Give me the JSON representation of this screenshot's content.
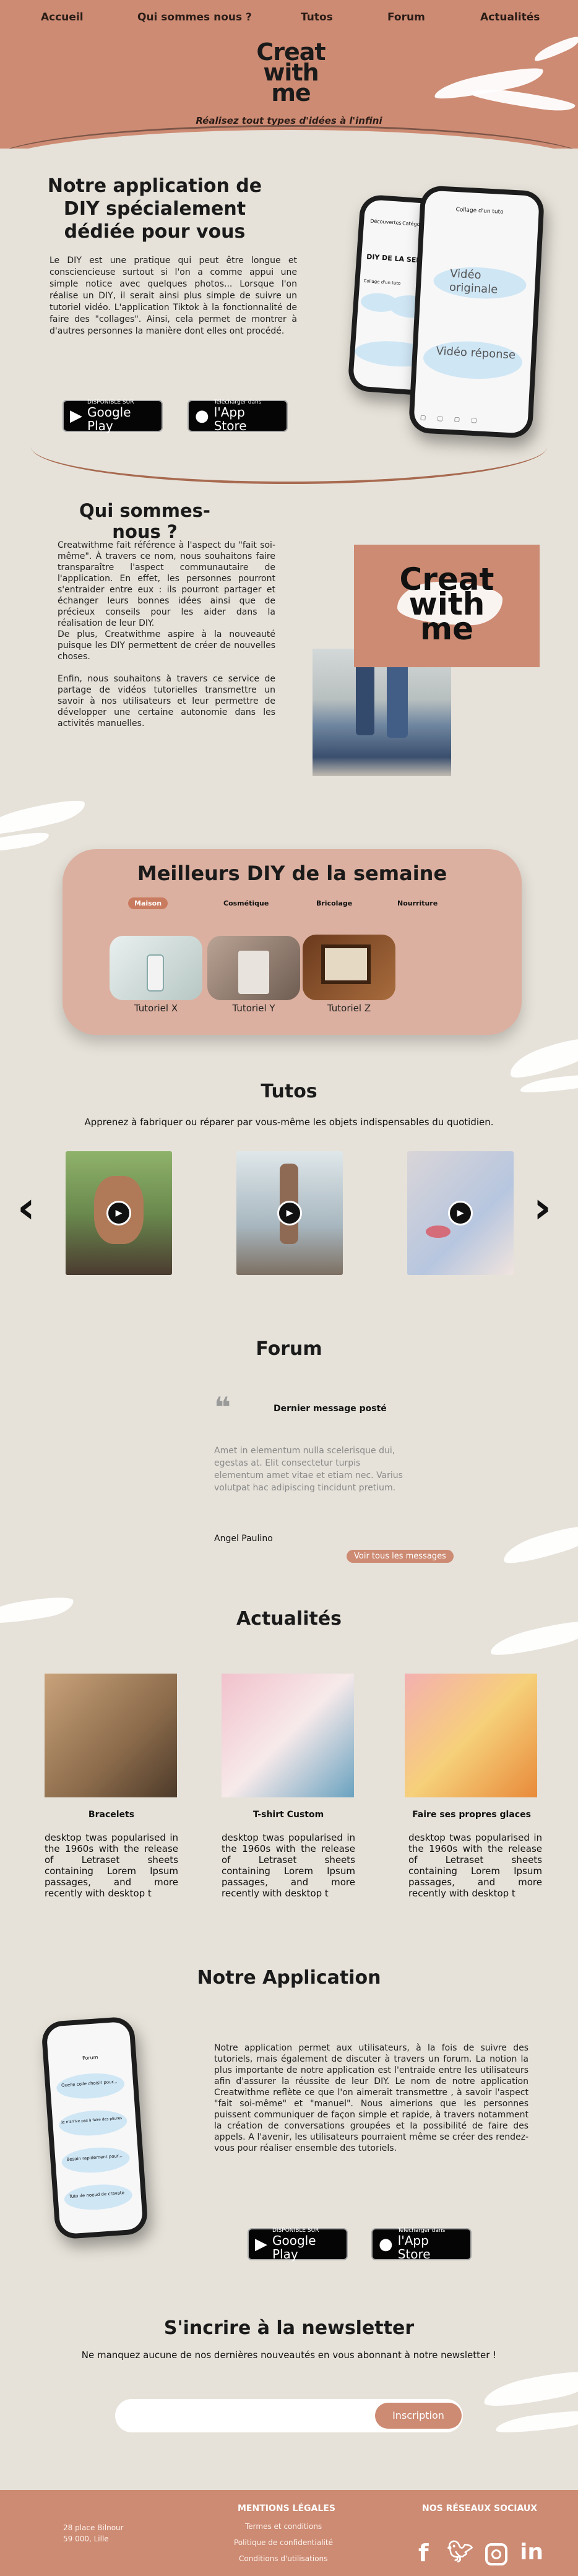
{
  "nav": {
    "accueil": "Accueil",
    "qui": "Qui sommes nous ?",
    "tutos": "Tutos",
    "forum": "Forum",
    "actualites": "Actualités"
  },
  "logo": {
    "line1": "Creat",
    "line2": "with",
    "line3": "me"
  },
  "tagline": "Réalisez tout types d'idées à l'infini",
  "intro": {
    "title": "Notre application de DIY spécialement dédiée pour vous",
    "body": "Le DIY est une pratique qui peut être longue et consciencieuse surtout si l'on a comme appui une simple notice avec quelques photos... Lorsque l'on réalise un DIY, il serait ainsi plus simple de suivre un tutoriel vidéo. L'application Tiktok à la fonctionnalité de faire des \"collages\". Ainsi, cela permet de montrer à d'autres personnes la manière dont elles ont procédé.",
    "phone_tab1": "Découvertes",
    "phone_tab2": "Catégories",
    "phone_heading": "DIY DE LA SEMAINE",
    "phone_strip": "Collage d'un tuto",
    "phone2_header": "Collage d'un tuto",
    "phone2_video1": "Vidéo originale",
    "phone2_video2": "Vidéo réponse"
  },
  "stores": {
    "google_small": "DISPONIBLE SUR",
    "google_big": "Google Play",
    "apple_small": "Télécharger dans",
    "apple_big": "l'App Store"
  },
  "about": {
    "title": "Qui sommes-nous ?",
    "body1": "Creatwithme fait référence à l'aspect du \"fait soi-même\". À travers ce nom, nous souhaitons faire transparaître l'aspect communautaire de l'application. En effet, les personnes pourront s'entraider entre eux : ils pourront partager et échanger leurs bonnes idées ainsi que de précieux conseils pour les aider dans la réalisation de leur DIY.",
    "body2": "De plus, Creatwithme aspire à la nouveauté puisque les DIY permettent de créer de nouvelles choses.",
    "body3": "Enfin, nous souhaitons à travers ce service de partage de vidéos tutorielles transmettre un savoir à nos utilisateurs et leur permettre de développer une certaine autonomie dans les activités manuelles."
  },
  "best": {
    "title": "Meilleurs DIY de la semaine",
    "tabs": [
      "Maison",
      "Cosmétique",
      "Bricolage",
      "Nourriture"
    ],
    "items": [
      "Tutoriel X",
      "Tutoriel Y",
      "Tutoriel Z"
    ]
  },
  "tutos": {
    "title": "Tutos",
    "subtitle": "Apprenez à fabriquer ou réparer par vous-même les objets indispensables du quotidien.",
    "prev": "‹",
    "next": "›"
  },
  "forum": {
    "title": "Forum",
    "quote": "66",
    "last": "Dernier message posté",
    "message": "Amet in elementum nulla scelerisque dui, egestas at. Elit consectetur turpis elementum amet vitae et etiam nec. Varius volutpat hac adipiscing tincidunt pretium.",
    "author": "Angel Paulino",
    "button": "Voir tous les messages"
  },
  "news": {
    "title": "Actualités",
    "cards": [
      {
        "title": "Bracelets",
        "body": "desktop twas popularised in the 1960s with the release of Letraset sheets containing Lorem Ipsum passages, and more recently with desktop t"
      },
      {
        "title": "T-shirt Custom",
        "body": "desktop twas popularised in the 1960s with the release of Letraset sheets containing Lorem Ipsum passages, and more recently with desktop t"
      },
      {
        "title": "Faire ses propres glaces",
        "body": "desktop twas popularised in the 1960s with the release of Letraset sheets containing Lorem Ipsum passages, and more recently with desktop t"
      }
    ]
  },
  "app": {
    "title": "Notre Application",
    "body": "Notre application permet aux utilisateurs, à la fois de suivre des tutoriels, mais également de discuter à travers un forum. La notion la plus importante de notre application est l'entraide entre les utilisateurs afin d'assurer la réussite de leur DIY. Le nom de notre application Creatwithme reflète ce que l'on aimerait transmettre , à savoir l'aspect \"fait soi-même\" et \"manuel\". Nous aimerions que les personnes puissent communiquer de façon simple et rapide, à travers notamment la création de conversations groupées et la possibilité de faire des appels. A l'avenir, les utilisateurs pourraient même se créer des rendez-vous pour réaliser ensemble des tutoriels.",
    "phone_label1": "Forum",
    "phone_label2": "Quelle colle choisir pour...",
    "phone_label3": "Je n'arrive pas à faire des pliures",
    "phone_label4": "Besoin rapidement pour...",
    "phone_label5": "Tuto de noeud de cravate"
  },
  "newsletter": {
    "title": "S'incrire à la newsletter",
    "subtitle": "Ne manquez aucune de nos dernières nouveautés en vous abonnant à notre newsletter !",
    "placeholder": "",
    "button": "Inscription"
  },
  "footer": {
    "address1": "28 place Bilnour",
    "address2": "59 000, Lille",
    "legal_title": "MENTIONS LÉGALES",
    "legal": [
      "Termes et conditions",
      "Politique de confidentialité",
      "Conditions d'utilisations"
    ],
    "social_title": "NOS RÉSEAUX SOCIAUX",
    "social": [
      "f",
      "t",
      "ig",
      "in"
    ]
  },
  "colors": {
    "brand": "#cd8b73",
    "background": "#e6e2d9",
    "accent": "#c97b5f"
  }
}
